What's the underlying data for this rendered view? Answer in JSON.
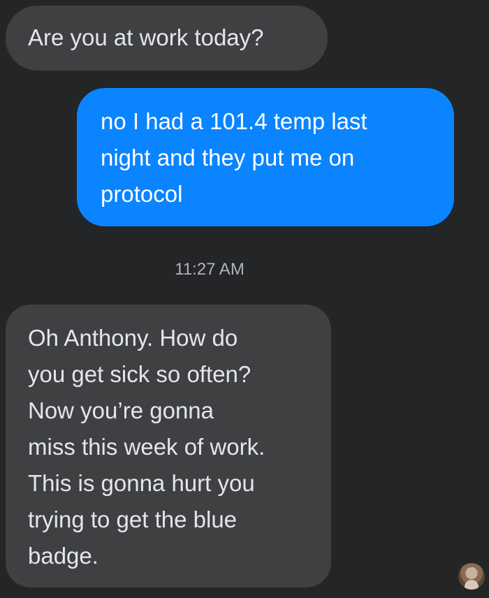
{
  "messages": [
    {
      "direction": "incoming",
      "text": "Are you at work today?"
    },
    {
      "direction": "outgoing",
      "text": "no I had a 101.4 temp last\nnight and they put me on\nprotocol"
    },
    {
      "direction": "incoming",
      "text": "Oh Anthony. How do\nyou get sick so often?\nNow you’re gonna\nmiss this week of work.\nThis is gonna hurt you\ntrying to get the blue\nbadge."
    }
  ],
  "timestamp": "11:27 AM",
  "colors": {
    "background": "#242526",
    "incoming_bubble": "#3e4042",
    "outgoing_bubble": "#0a84ff",
    "text": "#e4e6eb",
    "timestamp": "#b0b3b8"
  },
  "avatar_icon": "user-avatar-icon"
}
